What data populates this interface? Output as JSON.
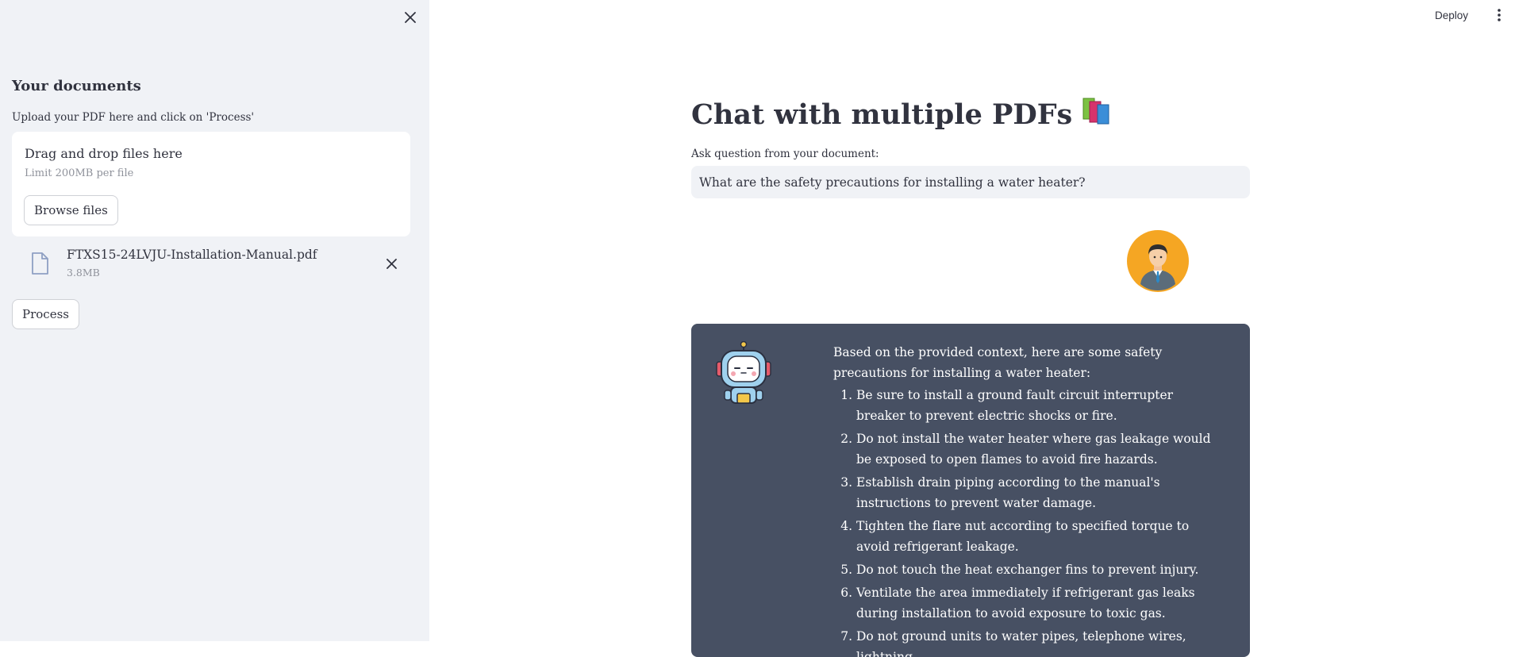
{
  "sidebar": {
    "close_icon": "close-icon",
    "title": "Your documents",
    "subtitle": "Upload your PDF here and click on 'Process'",
    "dropzone": {
      "title": "Drag and drop files here",
      "limit": "Limit 200MB per file",
      "browse_label": "Browse files"
    },
    "file": {
      "name": "FTXS15-24LVJU-Installation-Manual.pdf",
      "size": "3.8MB"
    },
    "process_label": "Process"
  },
  "header": {
    "deploy_label": "Deploy",
    "menu_icon": "kebab-menu-icon"
  },
  "main": {
    "title": "Chat with multiple PDFs",
    "title_emoji": "📚",
    "question_label": "Ask question from your document:",
    "question_value": "What are the safety precautions for installing a water heater?",
    "user_avatar_icon": "businessman-avatar-icon",
    "bot_avatar_icon": "robot-avatar-icon",
    "answer_intro": "Based on the provided context, here are some safety precautions for installing a water heater:",
    "answer_items": [
      "Be sure to install a ground fault circuit interrupter breaker to prevent electric shocks or fire.",
      "Do not install the water heater where gas leakage would be exposed to open flames to avoid fire hazards.",
      "Establish drain piping according to the manual's instructions to prevent water damage.",
      "Tighten the flare nut according to specified torque to avoid refrigerant leakage.",
      "Do not touch the heat exchanger fins to prevent injury.",
      "Ventilate the area immediately if refrigerant gas leaks during installation to avoid exposure to toxic gas.",
      "Do not ground units to water pipes, telephone wires, lightning"
    ]
  },
  "colors": {
    "sidebar_bg": "#f0f2f6",
    "bot_card_bg": "#475063",
    "avatar_orange": "#f5a623",
    "text": "#31333f"
  }
}
